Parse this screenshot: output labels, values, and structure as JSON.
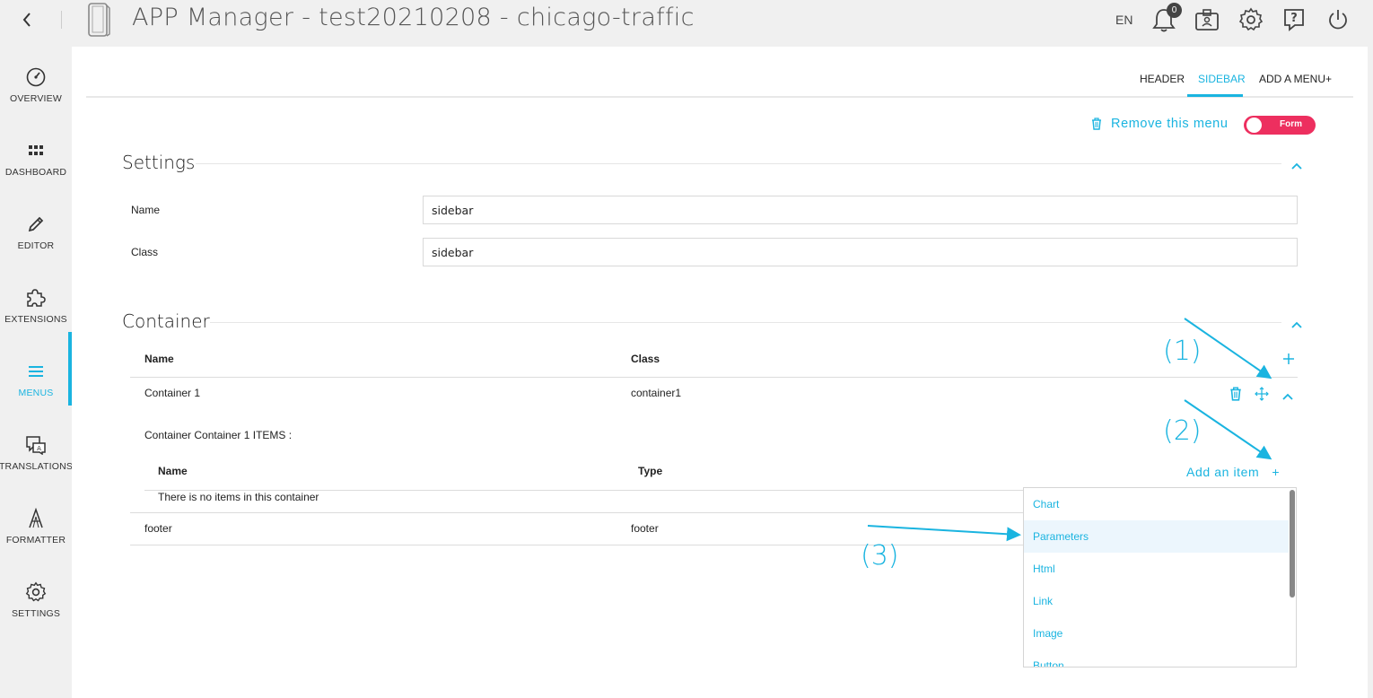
{
  "header": {
    "title": "APP Manager - test20210208 - chicago-traffic",
    "language": "EN",
    "notification_count": "0",
    "icons": [
      "back-icon",
      "app-logo-icon",
      "bell-icon",
      "badge-icon",
      "gear-icon",
      "help-icon",
      "power-icon"
    ]
  },
  "nav": {
    "items": [
      {
        "label": "OVERVIEW",
        "icon": "gauge-icon"
      },
      {
        "label": "DASHBOARD",
        "icon": "grid-icon"
      },
      {
        "label": "EDITOR",
        "icon": "pencil-icon"
      },
      {
        "label": "EXTENSIONS",
        "icon": "puzzle-icon"
      },
      {
        "label": "MENUS",
        "icon": "menu-icon"
      },
      {
        "label": "TRANSLATIONS",
        "icon": "translate-icon"
      },
      {
        "label": "FORMATTER",
        "icon": "formatter-icon"
      },
      {
        "label": "SETTINGS",
        "icon": "gear-icon"
      }
    ],
    "active": "MENUS"
  },
  "tabs": {
    "header": "HEADER",
    "sidebar": "SIDEBAR",
    "add_menu": "ADD A MENU",
    "add_menu_plus": "+",
    "active": "SIDEBAR"
  },
  "menu_actions": {
    "remove_label": "Remove this menu",
    "toggle_label": "Form"
  },
  "settings": {
    "title": "Settings",
    "name_label": "Name",
    "name_value": "sidebar",
    "class_label": "Class",
    "class_value": "sidebar"
  },
  "container": {
    "title": "Container",
    "columns": {
      "name": "Name",
      "class": "Class"
    },
    "rows": [
      {
        "name": "Container 1",
        "class": "container1"
      },
      {
        "name": "footer",
        "class": "footer"
      }
    ],
    "items_title": "Container Container 1 ITEMS :",
    "item_columns": {
      "name": "Name",
      "type": "Type"
    },
    "empty_message": "There is no items in this container",
    "add_item_label": "Add an item",
    "add_item_plus": "+"
  },
  "dropdown": {
    "options": [
      "Chart",
      "Parameters",
      "Html",
      "Link",
      "Image",
      "Button"
    ],
    "highlighted": "Parameters"
  },
  "annotations": [
    "(1)",
    "(2)",
    "(3)"
  ],
  "colors": {
    "accent": "#1ab4e0",
    "toggle": "#ed2f5f",
    "background": "#f0f0f0"
  }
}
